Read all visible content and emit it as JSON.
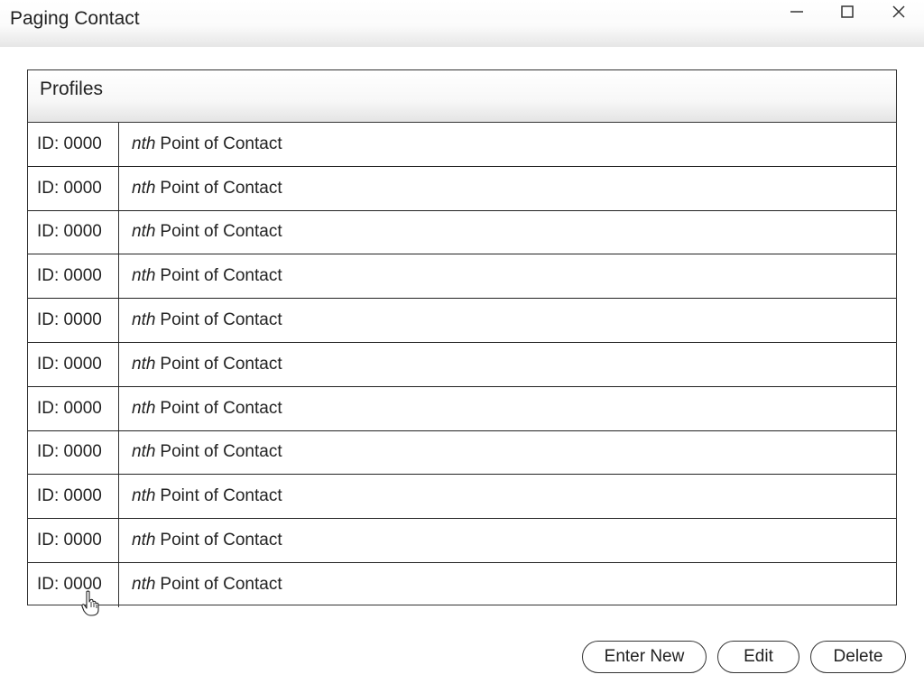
{
  "window": {
    "title": "Paging Contact",
    "controls": {
      "minimize_icon": "minimize-icon",
      "maximize_icon": "maximize-icon",
      "close_icon": "close-icon"
    }
  },
  "profiles": {
    "header": "Profiles",
    "rows": [
      {
        "id": "ID: 0000",
        "name_emphasis": "nth",
        "name": "Point of Contact"
      },
      {
        "id": "ID: 0000",
        "name_emphasis": "nth",
        "name": "Point of Contact"
      },
      {
        "id": "ID: 0000",
        "name_emphasis": "nth",
        "name": "Point of Contact"
      },
      {
        "id": "ID: 0000",
        "name_emphasis": "nth",
        "name": "Point of Contact"
      },
      {
        "id": "ID: 0000",
        "name_emphasis": "nth",
        "name": "Point of Contact"
      },
      {
        "id": "ID: 0000",
        "name_emphasis": "nth",
        "name": "Point of Contact"
      },
      {
        "id": "ID: 0000",
        "name_emphasis": "nth",
        "name": "Point of Contact"
      },
      {
        "id": "ID: 0000",
        "name_emphasis": "nth",
        "name": "Point of Contact"
      },
      {
        "id": "ID: 0000",
        "name_emphasis": "nth",
        "name": "Point of Contact"
      },
      {
        "id": "ID: 0000",
        "name_emphasis": "nth",
        "name": "Point of Contact"
      },
      {
        "id": "ID: 0000",
        "name_emphasis": "nth",
        "name": "Point of Contact"
      }
    ]
  },
  "actions": {
    "enter_new_label": "Enter New",
    "edit_label": "Edit",
    "delete_label": "Delete"
  },
  "cursor": {
    "icon": "hand-pointer-icon"
  }
}
